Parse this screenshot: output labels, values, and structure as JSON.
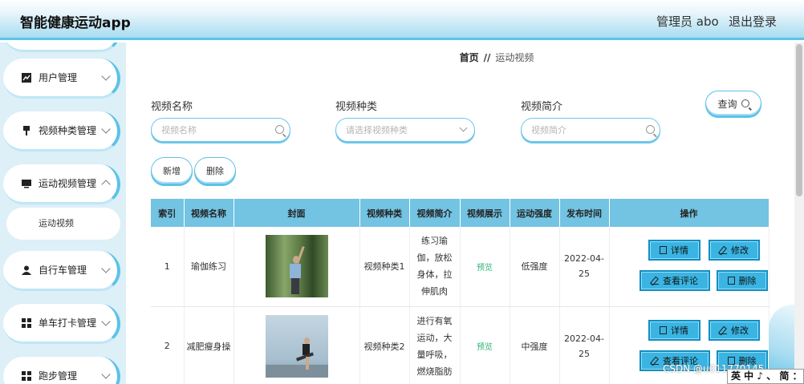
{
  "header": {
    "title": "智能健康运动app",
    "admin": "管理员 abo",
    "logout": "退出登录"
  },
  "sidebar": {
    "items": [
      {
        "label": "用户管理",
        "icon": "chart-icon"
      },
      {
        "label": "视频种类管理",
        "icon": "pin-icon"
      },
      {
        "label": "运动视频管理",
        "icon": "monitor-icon"
      },
      {
        "label": "自行车管理",
        "icon": "user-icon"
      },
      {
        "label": "单车打卡管理",
        "icon": "grid-icon"
      },
      {
        "label": "跑步管理",
        "icon": "grid-icon"
      }
    ],
    "sub_item": "运动视频"
  },
  "breadcrumb": {
    "home": "首页",
    "sep": "//",
    "current": "运动视频"
  },
  "filters": {
    "name": {
      "label": "视频名称",
      "placeholder": "视频名称"
    },
    "type": {
      "label": "视频种类",
      "placeholder": "请选择视频种类"
    },
    "intro": {
      "label": "视频简介",
      "placeholder": "视频简介"
    },
    "query": "查询"
  },
  "actions": {
    "add": "新增",
    "delete": "删除"
  },
  "table": {
    "columns": [
      "索引",
      "视频名称",
      "封面",
      "视频种类",
      "视频简介",
      "视频展示",
      "运动强度",
      "发布时间",
      "操作"
    ],
    "rows": [
      {
        "index": "1",
        "name": "瑜伽练习",
        "type": "视频种类1",
        "intro": "练习瑜伽，放松身体，拉伸肌肉",
        "show": "预览",
        "intensity": "低强度",
        "date": "2022-04-25"
      },
      {
        "index": "2",
        "name": "减肥瘦身操",
        "type": "视频种类2",
        "intro": "进行有氧运动，大量呼吸，燃烧脂肪",
        "show": "预览",
        "intensity": "中强度",
        "date": "2022-04-25"
      }
    ],
    "ops": {
      "detail": "详情",
      "edit": "修改",
      "comments": "查看评论",
      "delete": "删除"
    }
  },
  "watermark": "CSDN @u011770145",
  "ime": "英 中 ♪ 、 简 ："
}
